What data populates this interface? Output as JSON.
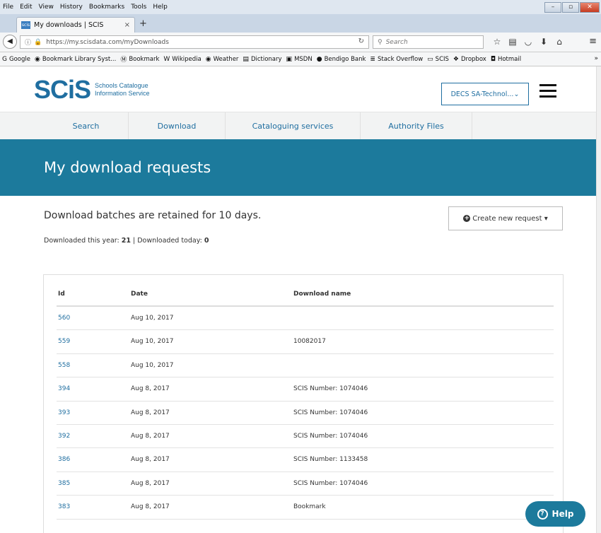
{
  "browser": {
    "menu": [
      "File",
      "Edit",
      "View",
      "History",
      "Bookmarks",
      "Tools",
      "Help"
    ],
    "tab_title": "My downloads | SCIS",
    "tab_favicon": "scis",
    "url": "https://my.scisdata.com/myDownloads",
    "search_placeholder": "Search",
    "bookmarks": [
      {
        "label": "Google",
        "icon": "G"
      },
      {
        "label": "Bookmark Library Syst...",
        "icon": "◉"
      },
      {
        "label": "Bookmark",
        "icon": "Ⓜ"
      },
      {
        "label": "Wikipedia",
        "icon": "W"
      },
      {
        "label": "Weather",
        "icon": "◉"
      },
      {
        "label": "Dictionary",
        "icon": "▤"
      },
      {
        "label": "MSDN",
        "icon": "▣"
      },
      {
        "label": "Bendigo Bank",
        "icon": "●"
      },
      {
        "label": "Stack Overflow",
        "icon": "≣"
      },
      {
        "label": "SCIS",
        "icon": "▭"
      },
      {
        "label": "Dropbox",
        "icon": "❖"
      },
      {
        "label": "Hotmail",
        "icon": "◘"
      }
    ]
  },
  "site": {
    "logo_mark": "SCiS",
    "logo_line1": "Schools Catalogue",
    "logo_line2": "Information Service",
    "account_label": "DECS SA-Technol...",
    "nav": [
      "Search",
      "Download",
      "Cataloguing services",
      "Authority Files"
    ]
  },
  "main": {
    "title": "My download requests",
    "retain_text": "Download batches are retained for 10 days.",
    "year_label": "Downloaded this year:",
    "year_count": "21",
    "today_label": "Downloaded today:",
    "today_count": "0",
    "create_label": "Create new request"
  },
  "table": {
    "headers": [
      "Id",
      "Date",
      "Download name"
    ],
    "rows": [
      {
        "id": "560",
        "date": "Aug 10, 2017",
        "name": ""
      },
      {
        "id": "559",
        "date": "Aug 10, 2017",
        "name": "10082017"
      },
      {
        "id": "558",
        "date": "Aug 10, 2017",
        "name": ""
      },
      {
        "id": "394",
        "date": "Aug 8, 2017",
        "name": "SCIS Number: 1074046"
      },
      {
        "id": "393",
        "date": "Aug 8, 2017",
        "name": "SCIS Number: 1074046"
      },
      {
        "id": "392",
        "date": "Aug 8, 2017",
        "name": "SCIS Number: 1074046"
      },
      {
        "id": "386",
        "date": "Aug 8, 2017",
        "name": "SCIS Number: 1133458"
      },
      {
        "id": "385",
        "date": "Aug 8, 2017",
        "name": "SCIS Number: 1074046"
      },
      {
        "id": "383",
        "date": "Aug 8, 2017",
        "name": "Bookmark"
      }
    ]
  },
  "help_label": "Help",
  "colors": {
    "brand": "#1f6ea0",
    "banner": "#1c7a9c"
  }
}
